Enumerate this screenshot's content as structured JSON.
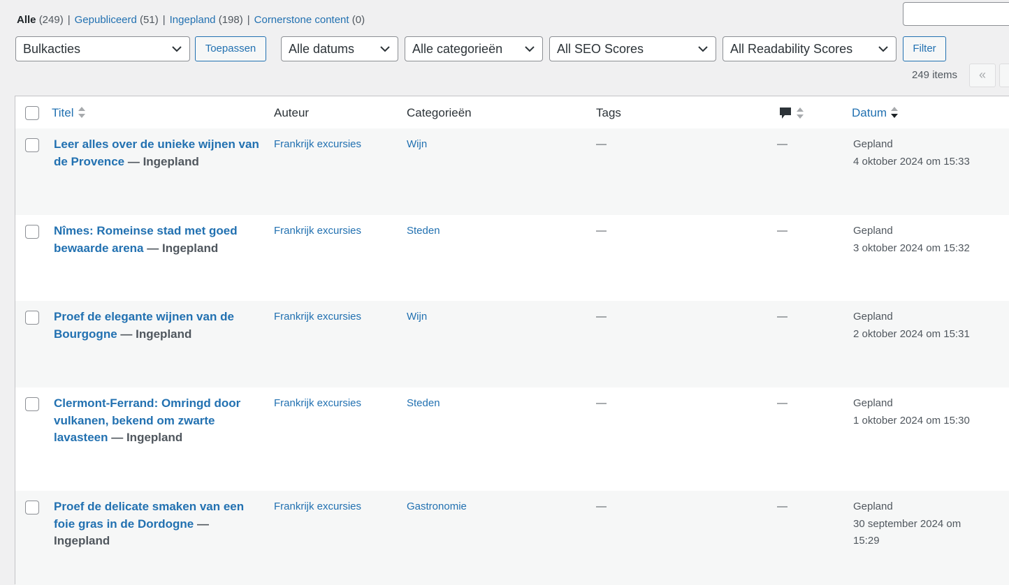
{
  "views": [
    {
      "label": "Alle",
      "count": "(249)"
    },
    {
      "label": "Gepubliceerd",
      "count": "(51)"
    },
    {
      "label": "Ingepland",
      "count": "(198)"
    },
    {
      "label": "Cornerstone content",
      "count": "(0)"
    }
  ],
  "separator": "|",
  "filters": {
    "bulk": "Bulkacties",
    "apply": "Toepassen",
    "dates": "Alle datums",
    "categories": "Alle categorieën",
    "seo": "All SEO Scores",
    "readability": "All Readability Scores",
    "filter": "Filter"
  },
  "pagination": {
    "items": "249 items",
    "first": "«"
  },
  "columns": {
    "title": "Titel",
    "author": "Auteur",
    "categories": "Categorieën",
    "tags": "Tags",
    "date": "Datum"
  },
  "posts": [
    {
      "title": "Leer alles over de unieke wijnen van de Provence",
      "state": "— Ingepland",
      "author": "Frankrijk excursies",
      "category": "Wijn",
      "tags": "—",
      "comments": "—",
      "status": "Gepland",
      "date": "4 oktober 2024 om 15:33"
    },
    {
      "title": "Nîmes: Romeinse stad met goed bewaarde arena",
      "state": "— Ingepland",
      "author": "Frankrijk excursies",
      "category": "Steden",
      "tags": "—",
      "comments": "—",
      "status": "Gepland",
      "date": "3 oktober 2024 om 15:32"
    },
    {
      "title": "Proef de elegante wijnen van de Bourgogne",
      "state": "— Ingepland",
      "author": "Frankrijk excursies",
      "category": "Wijn",
      "tags": "—",
      "comments": "—",
      "status": "Gepland",
      "date": "2 oktober 2024 om 15:31"
    },
    {
      "title": "Clermont-Ferrand: Omringd door vulkanen, bekend om zwarte lavasteen",
      "state": "— Ingepland",
      "author": "Frankrijk excursies",
      "category": "Steden",
      "tags": "—",
      "comments": "—",
      "status": "Gepland",
      "date": "1 oktober 2024 om 15:30"
    },
    {
      "title": "Proef de delicate smaken van een foie gras in de Dordogne",
      "state": "— Ingepland",
      "author": "Frankrijk excursies",
      "category": "Gastronomie",
      "tags": "—",
      "comments": "—",
      "status": "Gepland",
      "date": "30 september 2024 om 15:29"
    }
  ]
}
